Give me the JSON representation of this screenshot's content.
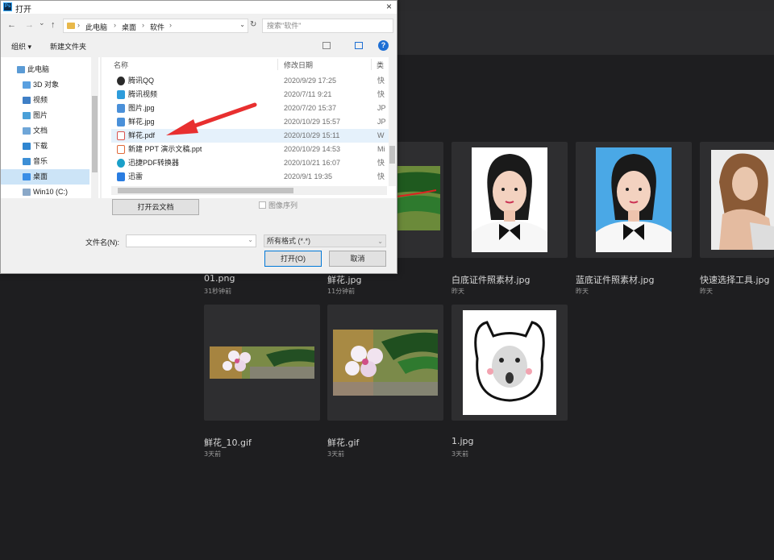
{
  "dialog": {
    "title": "打开",
    "close_glyph": "×",
    "logo_text": "Ps",
    "nav": {
      "back": "←",
      "forward": "→",
      "dropdown": "⌄",
      "up": "↑",
      "refresh": "↻"
    },
    "breadcrumb": [
      "此电脑",
      "桌面",
      "软件"
    ],
    "crumb_sep": "›",
    "search_placeholder": "搜索\"软件\"",
    "toolbar": {
      "organize": "组织 ▾",
      "new_folder": "新建文件夹",
      "help": "?"
    },
    "nav_pane": [
      {
        "label": "此电脑",
        "color": "#5b9bd5"
      },
      {
        "label": "3D 对象",
        "color": "#5aa0e0"
      },
      {
        "label": "视频",
        "color": "#3f7fc6"
      },
      {
        "label": "图片",
        "color": "#4ba0d8"
      },
      {
        "label": "文档",
        "color": "#6fa6d8"
      },
      {
        "label": "下载",
        "color": "#2f86d1"
      },
      {
        "label": "音乐",
        "color": "#3d8fd6"
      },
      {
        "label": "桌面",
        "color": "#3a8ee6"
      },
      {
        "label": "Win10 (C:)",
        "color": "#8aa8c8"
      }
    ],
    "columns": {
      "name": "名称",
      "date": "修改日期",
      "type": "类"
    },
    "files": [
      {
        "name": "腾讯QQ",
        "date": "2020/9/29 17:25",
        "type": "快",
        "color": "#2a2a2a"
      },
      {
        "name": "腾讯视频",
        "date": "2020/7/11 9:21",
        "type": "快",
        "color": "#2d9cdb"
      },
      {
        "name": "图片.jpg",
        "date": "2020/7/20 15:37",
        "type": "JP",
        "color": "#4a90d9"
      },
      {
        "name": "鲜花.jpg",
        "date": "2020/10/29 15:57",
        "type": "JP",
        "color": "#4a90d9"
      },
      {
        "name": "鲜花.pdf",
        "date": "2020/10/29 15:11",
        "type": "W",
        "color": "#d9534f"
      },
      {
        "name": "新建 PPT 演示文稿.ppt",
        "date": "2020/10/29 14:53",
        "type": "Mi",
        "color": "#e06a3a"
      },
      {
        "name": "迅捷PDF转换器",
        "date": "2020/10/21 16:07",
        "type": "快",
        "color": "#1aa0c9"
      },
      {
        "name": "迅雷",
        "date": "2020/9/1 19:35",
        "type": "快",
        "color": "#2a7de1"
      }
    ],
    "cloud_button": "打开云文档",
    "image_sequence": "图像序列",
    "filename_label": "文件名(N):",
    "filename_value": "",
    "format_value": "所有格式 (*.*)",
    "open_button": "打开(O)",
    "cancel_button": "取消",
    "accent": "#0078d7"
  },
  "recent_files": [
    {
      "name": "01.png",
      "time": "31秒钟前"
    },
    {
      "name": "鲜花.jpg",
      "time": "11分钟前"
    },
    {
      "name": "白底证件照素材.jpg",
      "time": "昨天"
    },
    {
      "name": "蓝底证件照素材.jpg",
      "time": "昨天"
    },
    {
      "name": "快速选择工具.jpg",
      "time": "昨天"
    },
    {
      "name": "鲜花_10.gif",
      "time": "3天前"
    },
    {
      "name": "鲜花.gif",
      "time": "3天前"
    },
    {
      "name": "1.jpg",
      "time": "3天前"
    }
  ]
}
